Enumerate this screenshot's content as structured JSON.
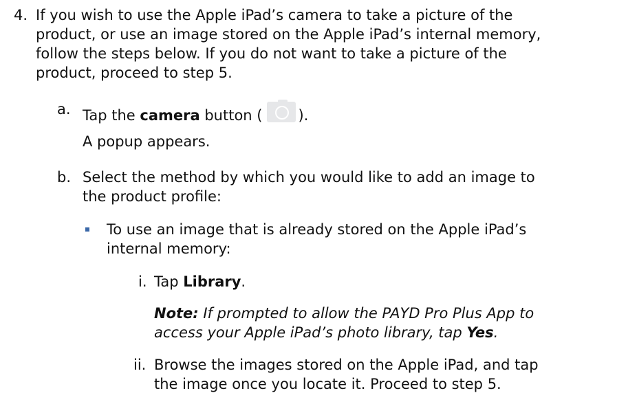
{
  "step4": {
    "number": "4.",
    "lines": [
      "If you wish to use the Apple iPad’s camera to take a picture of the",
      "product, or use an image stored on the Apple iPad’s internal memory,",
      "follow the steps below. If you do not want to take a picture of the",
      "product, proceed to step 5."
    ]
  },
  "step_a": {
    "letter": "a.",
    "prefix": "Tap the ",
    "bold": "camera",
    "suffix_open": " button (",
    "suffix_close": ").",
    "result": "A popup appears.",
    "icon": "camera-icon",
    "icon_color": "#e6e7e9"
  },
  "step_b": {
    "letter": "b.",
    "lines": [
      "Select the method by which you would like to add an image to",
      "the product profile:"
    ]
  },
  "option1": {
    "lines": [
      "To use an image that is already stored on the Apple iPad’s",
      "internal memory:"
    ],
    "bullet_color": "#3a68a8"
  },
  "sub_i": {
    "numeral": "i.",
    "prefix": "Tap ",
    "bold": "Library",
    "suffix": ".",
    "note_label": "Note:",
    "note_line1": " If prompted to allow the PAYD Pro Plus App to",
    "note_line2_prefix": "access your Apple iPad’s photo library, tap ",
    "note_bold": "Yes",
    "note_suffix": "."
  },
  "sub_ii": {
    "numeral": "ii.",
    "lines": [
      "Browse the images stored on the Apple iPad, and tap",
      "the image once you locate it. Proceed to step 5."
    ]
  }
}
